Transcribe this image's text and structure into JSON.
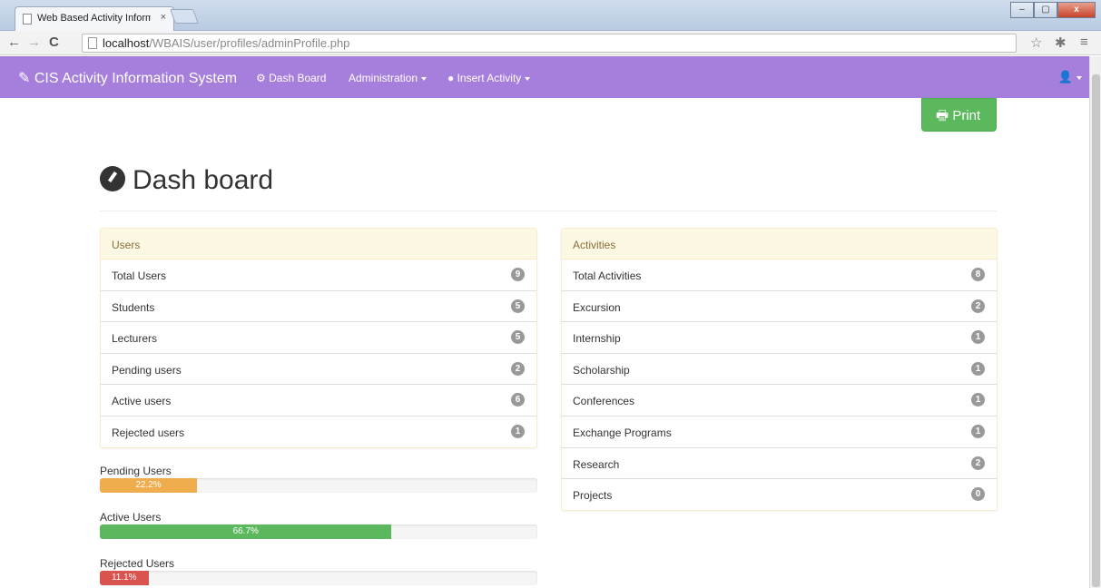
{
  "browser": {
    "tab_title": "Web Based Activity Inform",
    "tab_close": "×",
    "url_host": "localhost",
    "url_path": "/WBAIS/user/profiles/adminProfile.php",
    "window_controls": [
      "–",
      "▢",
      "x"
    ]
  },
  "navbar": {
    "brand": "CIS Activity Information System",
    "links": [
      {
        "label": "Dash Board",
        "icon": "dashboard-icon"
      },
      {
        "label": "Administration",
        "dropdown": true
      },
      {
        "label": "Insert Activity",
        "icon": "plus-circle-icon",
        "dropdown": true
      }
    ],
    "user_icon": "user-icon",
    "color": "#a67fdc"
  },
  "print_button": {
    "label": "Print",
    "icon": "print-icon",
    "color": "#5cb85c"
  },
  "page_title": "Dash board",
  "users_panel": {
    "heading": "Users",
    "rows": [
      {
        "label": "Total Users",
        "count": "9"
      },
      {
        "label": "Students",
        "count": "5"
      },
      {
        "label": "Lecturers",
        "count": "5"
      },
      {
        "label": "Pending users",
        "count": "2"
      },
      {
        "label": "Active users",
        "count": "6"
      },
      {
        "label": "Rejected users",
        "count": "1"
      }
    ]
  },
  "activities_panel": {
    "heading": "Activities",
    "rows": [
      {
        "label": "Total Activities",
        "count": "8"
      },
      {
        "label": "Excursion",
        "count": "2"
      },
      {
        "label": "Internship",
        "count": "1"
      },
      {
        "label": "Scholarship",
        "count": "1"
      },
      {
        "label": "Conferences",
        "count": "1"
      },
      {
        "label": "Exchange Programs",
        "count": "1"
      },
      {
        "label": "Research",
        "count": "2"
      },
      {
        "label": "Projects",
        "count": "0"
      }
    ]
  },
  "progress_bars": [
    {
      "label": "Pending Users",
      "percent_text": "22.2%",
      "value": 22.2,
      "color": "#f0ad4e"
    },
    {
      "label": "Active Users",
      "percent_text": "66.7%",
      "value": 66.7,
      "color": "#5cb85c"
    },
    {
      "label": "Rejected Users",
      "percent_text": "11.1%",
      "value": 11.1,
      "color": "#d9534f"
    }
  ]
}
